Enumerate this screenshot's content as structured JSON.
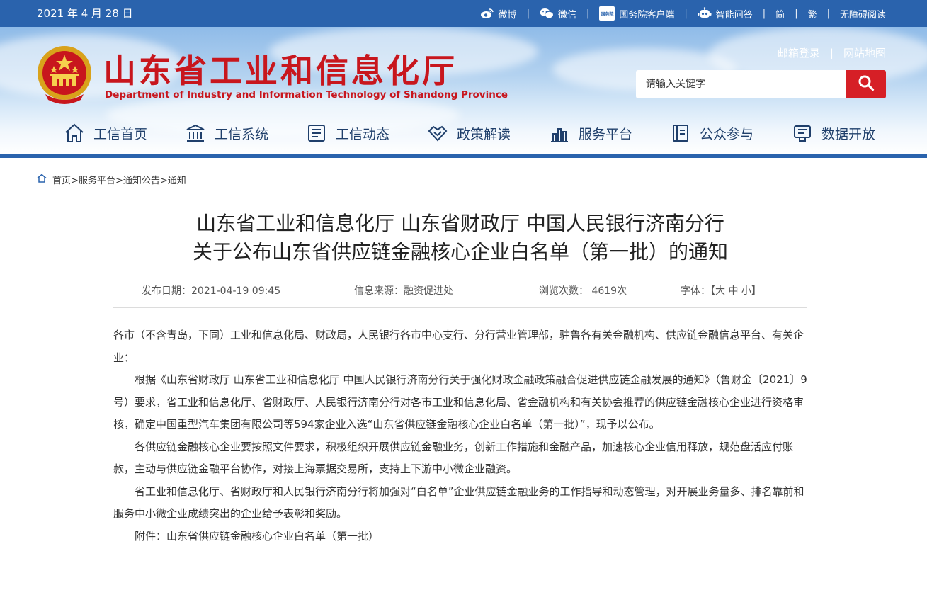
{
  "topbar": {
    "date": "2021 年 4 月 28 日",
    "links": [
      {
        "label": "微博",
        "icon": "weibo-icon"
      },
      {
        "label": "微信",
        "icon": "wechat-icon"
      },
      {
        "label": "国务院客户端",
        "icon": "gov-app-icon",
        "badge": "国务院"
      },
      {
        "label": "智能问答",
        "icon": "robot-icon"
      },
      {
        "label": "简"
      },
      {
        "label": "繁"
      },
      {
        "label": "无障碍阅读"
      }
    ],
    "separator": "|"
  },
  "header": {
    "title": "山东省工业和信息化厅",
    "subtitle": "Department of Industry and Information Technology of Shandong Province",
    "links": [
      "邮箱登录",
      "网站地图"
    ],
    "search_placeholder": "请输入关键字"
  },
  "nav": [
    {
      "label": "工信首页",
      "icon": "home-icon"
    },
    {
      "label": "工信系统",
      "icon": "institution-icon"
    },
    {
      "label": "工信动态",
      "icon": "news-icon"
    },
    {
      "label": "政策解读",
      "icon": "handshake-icon"
    },
    {
      "label": "服务平台",
      "icon": "bar-chart-icon"
    },
    {
      "label": "公众参与",
      "icon": "book-icon"
    },
    {
      "label": "数据开放",
      "icon": "data-icon"
    }
  ],
  "breadcrumb": {
    "items": [
      "首页",
      "服务平台",
      "通知公告",
      "通知"
    ],
    "sep": ">"
  },
  "article": {
    "title_line1": "山东省工业和信息化厅 山东省财政厅 中国人民银行济南分行",
    "title_line2": "关于公布山东省供应链金融核心企业白名单（第一批）的通知",
    "publish_date": "发布日期：2021-04-19 09:45",
    "source": "信息来源：融资促进处",
    "views": "浏览次数： 4619次",
    "font_size_label": "字体：",
    "font_size_open": "【",
    "font_size_options": [
      "大",
      "中",
      "小"
    ],
    "font_size_close": "】",
    "paragraphs": [
      "各市（不含青岛，下同）工业和信息化局、财政局，人民银行各市中心支行、分行营业管理部，驻鲁各有关金融机构、供应链金融信息平台、有关企业：",
      "根据《山东省财政厅 山东省工业和信息化厅 中国人民银行济南分行关于强化财政金融政策融合促进供应链金融发展的通知》（鲁财金〔2021〕9号）要求，省工业和信息化厅、省财政厅、人民银行济南分行对各市工业和信息化局、省金融机构和有关协会推荐的供应链金融核心企业进行资格审核，确定中国重型汽车集团有限公司等594家企业入选“山东省供应链金融核心企业白名单（第一批）”，现予以公布。",
      "各供应链金融核心企业要按照文件要求，积极组织开展供应链金融业务，创新工作措施和金融产品，加速核心企业信用释放，规范盘活应付账款，主动与供应链金融平台协作，对接上海票据交易所，支持上下游中小微企业融资。",
      "省工业和信息化厅、省财政厅和人民银行济南分行将加强对“白名单”企业供应链金融业务的工作指导和动态管理，对开展业务量多、排名靠前和服务中小微企业成绩突出的企业给予表彰和奖励。",
      "附件：山东省供应链金融核心企业白名单（第一批）"
    ]
  },
  "colors": {
    "brand_blue": "#2a63ad",
    "title_red": "#c8161d",
    "search_red": "#d61f26"
  }
}
